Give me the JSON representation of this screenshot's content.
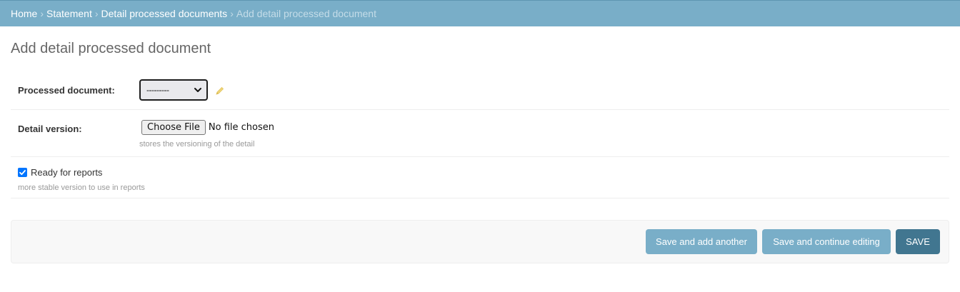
{
  "breadcrumbs": {
    "home": "Home",
    "sep1": "›",
    "statement": "Statement",
    "sep2": "›",
    "detail_docs": "Detail processed documents",
    "sep3": "›",
    "current": "Add detail processed document"
  },
  "page": {
    "title": "Add detail processed document"
  },
  "form": {
    "processed_document": {
      "label": "Processed document:",
      "selected_value": "---------",
      "edit_icon": "pencil-icon"
    },
    "detail_version": {
      "label": "Detail version:",
      "button_label": "Choose File",
      "status": "No file chosen",
      "help": "stores the versioning of the detail"
    },
    "ready_for_reports": {
      "label": "Ready for reports",
      "checked": true,
      "help": "more stable version to use in reports"
    }
  },
  "submit": {
    "save_add_another": "Save and add another",
    "save_continue": "Save and continue editing",
    "save": "Save"
  },
  "colors": {
    "header_bg": "#79aec8",
    "button_secondary": "#79aec8",
    "button_primary": "#417690",
    "checkbox": "#0075ff",
    "pencil": "#efd67a"
  }
}
